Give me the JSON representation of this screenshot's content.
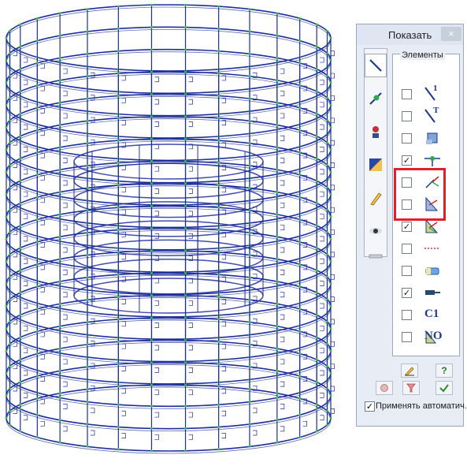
{
  "panel": {
    "title": "Показать",
    "close_symbol": "×",
    "group_label": "Элементы",
    "auto_apply_label": "Применять автоматич.",
    "auto_apply_checked": true
  },
  "tabs": [
    {
      "icon": "bar-element-icon",
      "active": true
    },
    {
      "icon": "node-icon",
      "active": false
    },
    {
      "icon": "load-icon",
      "active": false
    },
    {
      "icon": "color-fill-icon",
      "active": false
    },
    {
      "icon": "pencil-edit-icon",
      "active": false
    },
    {
      "icon": "eye-icon",
      "active": false
    },
    {
      "icon": "ruler-icon",
      "active": false
    }
  ],
  "elements": [
    {
      "checked": false,
      "icon": "bar-number-icon",
      "text": "1"
    },
    {
      "checked": false,
      "icon": "bar-type-icon",
      "text": "T"
    },
    {
      "checked": false,
      "icon": "cross-section-icon",
      "text": ""
    },
    {
      "checked": true,
      "icon": "node-support-icon",
      "text": ""
    },
    {
      "checked": false,
      "icon": "local-axes-icon",
      "text": ""
    },
    {
      "checked": false,
      "icon": "plate-axes-icon",
      "text": ""
    },
    {
      "checked": true,
      "icon": "plate-local-axes-icon",
      "text": ""
    },
    {
      "checked": false,
      "icon": "dimension-line-icon",
      "text": ""
    },
    {
      "checked": false,
      "icon": "eraser-icon",
      "text": ""
    },
    {
      "checked": true,
      "icon": "hinge-icon",
      "text": ""
    },
    {
      "checked": false,
      "icon": "c1-icon",
      "text": "C1"
    },
    {
      "checked": false,
      "icon": "no-icon",
      "text": "NO"
    }
  ],
  "buttons": [
    {
      "name": "pencil-button",
      "icon": "pencil-icon"
    },
    {
      "name": "help-button",
      "icon": "question-icon",
      "text": "?"
    },
    {
      "name": "refresh-button",
      "icon": "refresh-icon"
    },
    {
      "name": "filter-button",
      "icon": "filter-icon"
    },
    {
      "name": "apply-button",
      "icon": "checkmark-icon"
    }
  ],
  "colors": {
    "mesh_line": "#1e2e9a",
    "node_dot": "#22cc33",
    "highlight": "#e0202a",
    "panel_bg": "#e8edf5"
  }
}
